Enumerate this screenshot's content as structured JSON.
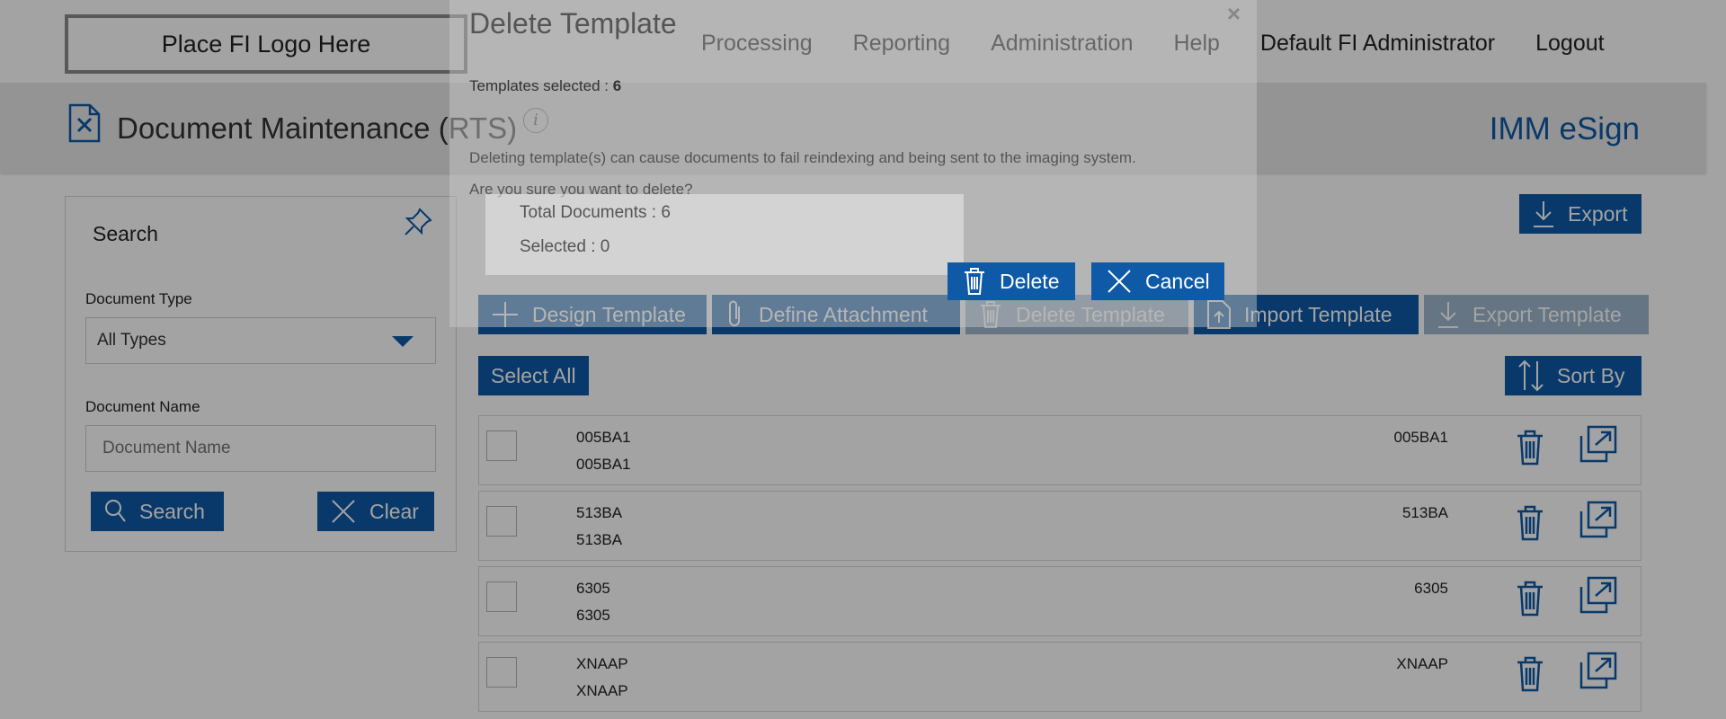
{
  "header": {
    "logo_text": "Place FI Logo Here",
    "nav": [
      "Processing",
      "Reporting",
      "Administration",
      "Help"
    ],
    "user": "Default FI Administrator",
    "logout": "Logout"
  },
  "page": {
    "title": "Document Maintenance (RTS)",
    "brand": "IMM eSign"
  },
  "search": {
    "title": "Search",
    "doc_type_label": "Document Type",
    "doc_type_value": "All Types",
    "doc_name_label": "Document Name",
    "doc_name_placeholder": "Document Name",
    "search_label": "Search",
    "clear_label": "Clear"
  },
  "actions": {
    "export": "Export",
    "design_template": "Design Template",
    "define_attachment": "Define Attachment",
    "delete_template": "Delete Template",
    "import_template": "Import Template",
    "export_template": "Export Template",
    "select_all": "Select All",
    "sort_by": "Sort By"
  },
  "rows": [
    {
      "name": "005BA1",
      "desc": "005BA1",
      "code": "005BA1"
    },
    {
      "name": "513BA",
      "desc": "513BA",
      "code": "513BA"
    },
    {
      "name": "6305",
      "desc": "6305",
      "code": "6305"
    },
    {
      "name": "XNAAP",
      "desc": "XNAAP",
      "code": "XNAAP"
    }
  ],
  "dialog": {
    "title": "Delete Template",
    "close": "×",
    "templates_selected_label": "Templates selected : ",
    "templates_selected_count": "6",
    "info_glyph": "i",
    "warning": "Deleting template(s) can cause documents to fail reindexing and being sent to the imaging system.",
    "question": "Are you sure you want to delete?",
    "total_documents": "Total Documents : 6",
    "selected": "Selected : 0",
    "delete_label": "Delete",
    "cancel_label": "Cancel"
  },
  "colors": {
    "accent": "#0e5aa7",
    "disabled": "#9fb8cf"
  },
  "icons": {
    "page": "document-tools-icon",
    "pin": "pin-icon",
    "search": "search-icon",
    "clear": "close-icon",
    "export": "download-icon",
    "design": "plus-icon",
    "attach": "paperclip-icon",
    "delete": "trash-icon",
    "import": "upload-icon",
    "sort": "sort-arrows-icon",
    "open": "open-external-icon"
  }
}
